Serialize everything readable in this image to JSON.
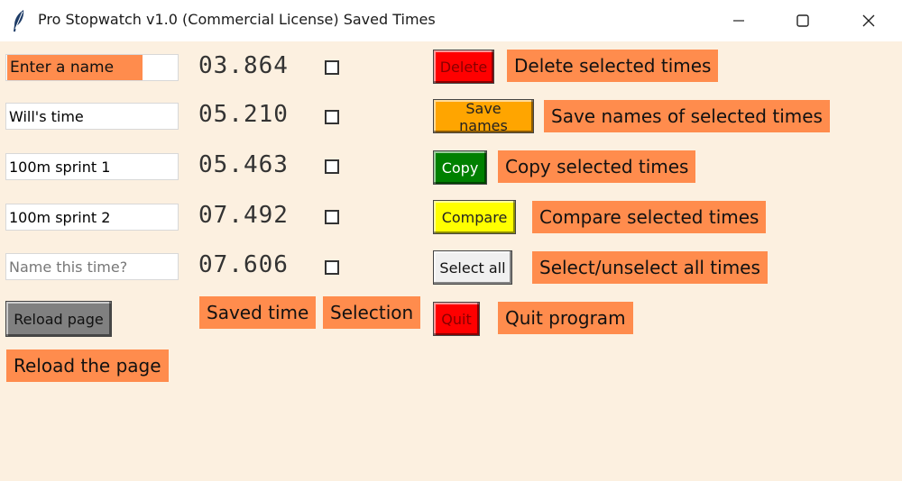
{
  "window": {
    "title": "Pro Stopwatch v1.0 (Commercial License) Saved Times",
    "icon": "feather-icon",
    "controls": [
      "minimize-icon",
      "maximize-icon",
      "close-icon"
    ]
  },
  "rows": [
    {
      "name_placeholder": "Enter a name",
      "name_value": "",
      "hint": "Enter a name",
      "time": "03.864",
      "checked": false
    },
    {
      "name_placeholder": "",
      "name_value": "Will's time",
      "time": "05.210",
      "checked": false
    },
    {
      "name_placeholder": "",
      "name_value": "100m sprint 1",
      "time": "05.463",
      "checked": false
    },
    {
      "name_placeholder": "",
      "name_value": "100m sprint 2",
      "time": "07.492",
      "checked": false
    },
    {
      "name_placeholder": "Name this time?",
      "name_value": "",
      "time": "07.606",
      "checked": false
    }
  ],
  "buttons": {
    "delete": {
      "label": "Delete",
      "bg": "#ff0000",
      "fg": "#880000",
      "description": "Delete selected times"
    },
    "save_names": {
      "label": "Save names",
      "bg": "#ffa500",
      "fg": "#222222",
      "description": "Save names of selected times"
    },
    "copy": {
      "label": "Copy",
      "bg": "#008000",
      "fg": "#ffffff",
      "description": "Copy selected times"
    },
    "compare": {
      "label": "Compare",
      "bg": "#ffff00",
      "fg": "#222222",
      "description": "Compare selected times"
    },
    "select_all": {
      "label": "Select all",
      "bg": "#f0f0f0",
      "fg": "#111111",
      "description": "Select/unselect all times"
    },
    "quit": {
      "label": "Quit",
      "bg": "#ff0000",
      "fg": "#880000",
      "description": "Quit program"
    },
    "reload": {
      "label": "Reload page",
      "bg": "#808080",
      "fg": "#111111",
      "description": "Reload the page"
    }
  },
  "column_labels": {
    "saved_time": "Saved time",
    "selection": "Selection"
  },
  "colors": {
    "background": "#fcf0e0",
    "annotation": "#ff8c4d"
  }
}
